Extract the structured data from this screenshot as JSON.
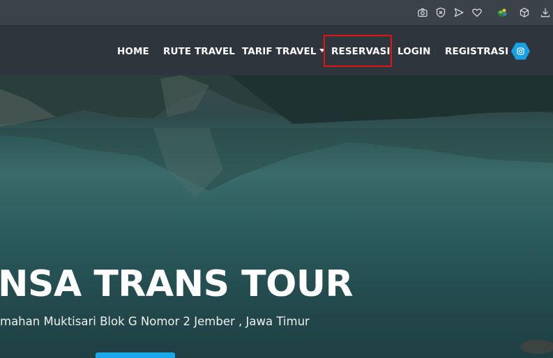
{
  "browser_toolbar": {
    "icons": [
      "camera-icon",
      "shield-x-icon",
      "send-icon",
      "heart-icon",
      "extension-globe-icon",
      "cube-icon",
      "download-icon"
    ]
  },
  "navbar": {
    "items": [
      {
        "label": "HOME"
      },
      {
        "label": "RUTE TRAVEL"
      },
      {
        "label": "TARIF TRAVEL",
        "dropdown": true
      },
      {
        "label": "RESERVASI",
        "highlighted": true
      },
      {
        "label": "LOGIN"
      },
      {
        "label": "REGISTRASI"
      }
    ],
    "social_icon": "instagram-icon",
    "accent_color": "#17a2e8",
    "highlight_color": "#e01515"
  },
  "hero": {
    "title": "NSA TRANS TOUR",
    "address": "mahan Muktisari Blok G Nomor 2 Jember , Jawa Timur",
    "button_color": "#16a8ea"
  }
}
